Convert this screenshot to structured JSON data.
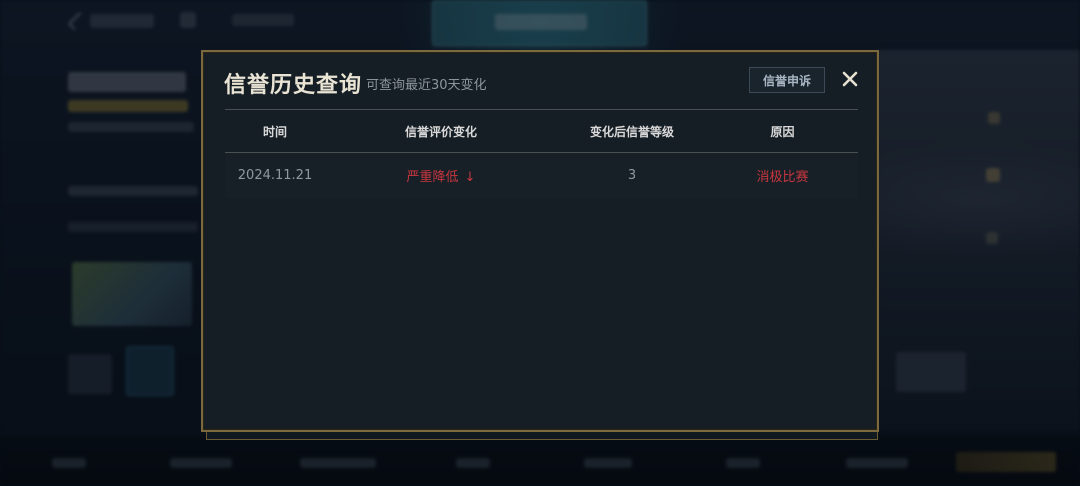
{
  "dialog": {
    "title": "信誉历史查询",
    "subtitle": "可查询最近30天变化",
    "appeal_label": "信誉申诉",
    "close_icon": "close-icon"
  },
  "table": {
    "columns": [
      "时间",
      "信誉评价变化",
      "变化后信誉等级",
      "原因"
    ],
    "rows": [
      {
        "date": "2024.11.21",
        "change": "严重降低",
        "change_icon": "down-arrow-icon",
        "level": "3",
        "reason": "消极比赛"
      }
    ]
  },
  "colors": {
    "accent_gold": "#7c6a3f",
    "negative_red": "#c7363f",
    "panel_bg": "#161e25"
  }
}
